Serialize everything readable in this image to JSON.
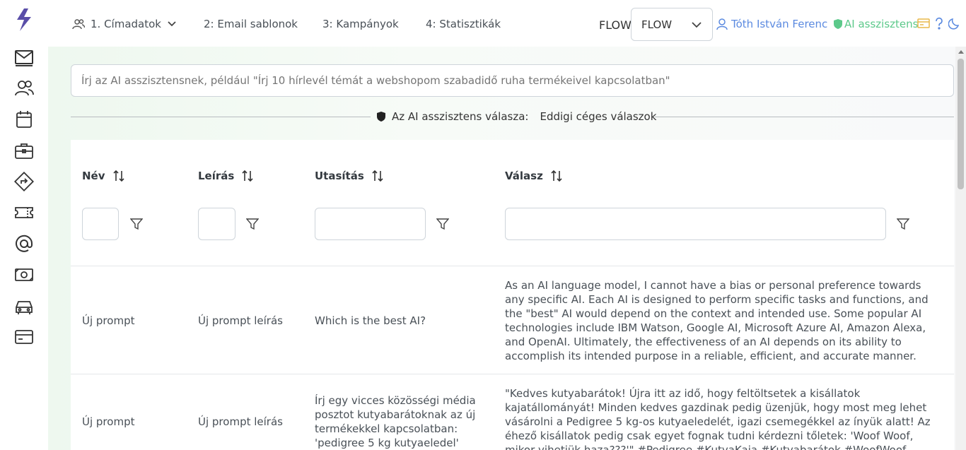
{
  "nav": {
    "items": [
      {
        "label": "1. Címadatok"
      },
      {
        "label": "2: Email sablonok"
      },
      {
        "label": "3: Kampányok"
      },
      {
        "label": "4: Statisztikák"
      }
    ],
    "flow_label": "FLOW",
    "flow_select_value": "FLOW",
    "user_name": "Tóth István Ferenc",
    "ai_assistant_label": "AI asszisztens"
  },
  "main": {
    "ai_input_placeholder": "Írj az AI asszisztensnek, például \"Írj 10 hírlevél témát a webshopom szabadidő ruha termékeivel kapcsolatban\"",
    "divider_label": "Az AI asszisztens válasza:",
    "divider_tab": "Eddigi céges válaszok"
  },
  "table": {
    "columns": [
      {
        "label": "Név"
      },
      {
        "label": "Leírás"
      },
      {
        "label": "Utasítás"
      },
      {
        "label": "Válasz"
      }
    ],
    "rows": [
      {
        "name": "Új prompt",
        "description": "Új prompt leírás",
        "instruction": "Which is the best AI?",
        "response": "As an AI language model, I cannot have a bias or personal preference towards any specific AI. Each AI is designed to perform specific tasks and functions, and the \"best\" AI would depend on the context and intended use. Some popular AI technologies include IBM Watson, Google AI, Microsoft Azure AI, Amazon Alexa, and OpenAI. Ultimately, the effectiveness of an AI depends on its ability to accomplish its intended purpose in a reliable, efficient, and accurate manner."
      },
      {
        "name": "Új prompt",
        "description": "Új prompt leírás",
        "instruction": "Írj egy vicces közösségi média posztot kutyabarátoknak az új termékekkel kapcsolatban: 'pedigree 5 kg kutyaeledel'",
        "response": "\"Kedves kutyabarátok! Újra itt az idő, hogy feltöltsetek a kisállatok kajatállományát! Minden kedves gazdinak pedig üzenjük, hogy most meg lehet vásárolni a Pedigree 5 kg-os kutyaeledelét, igazi csemegékkel az ínyük alatt! Az éhező kisállatok pedig csak egyet fognak tudni kérdezni tőletek: 'Woof Woof, mikor vihetjük haza???'\" #Pedigree #KutyaKaja #Kutyabarátok #WoofWoof"
      }
    ]
  },
  "colors": {
    "accent_blue": "#5b8ae0",
    "accent_green": "#5cc98a",
    "logo_purple": "#5a4ea8"
  }
}
